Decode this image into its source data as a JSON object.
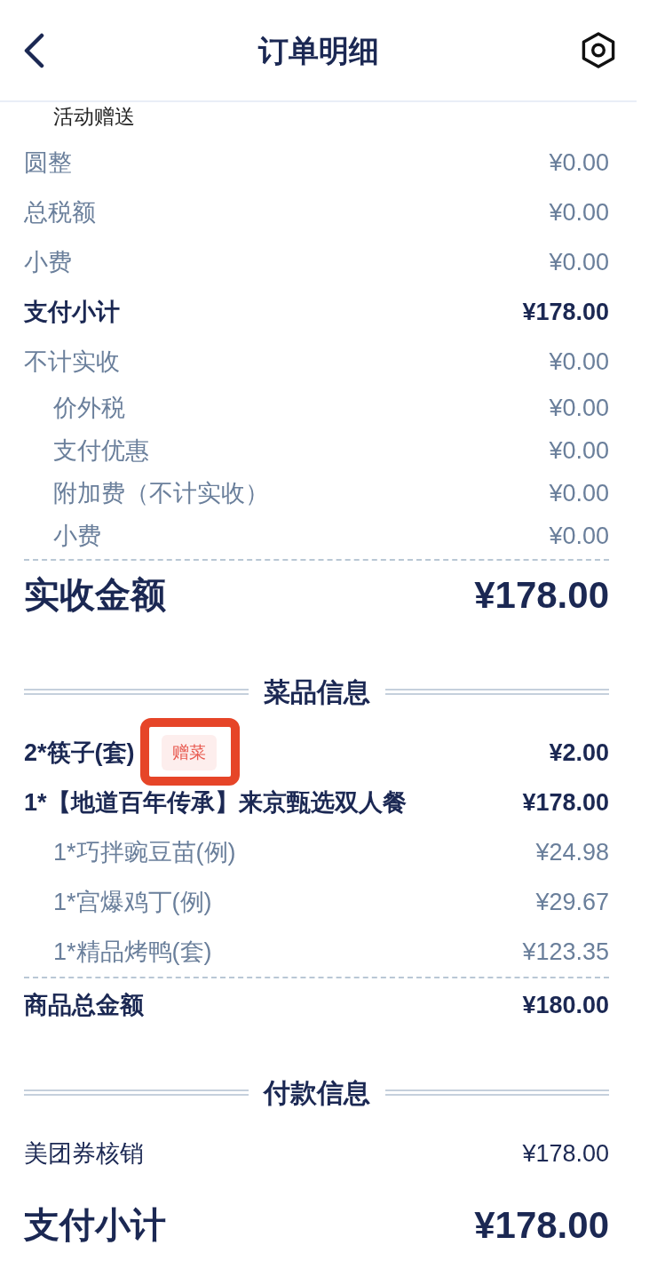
{
  "header": {
    "title": "订单明细"
  },
  "amounts": [
    {
      "kind": "note",
      "label": "活动赠送"
    },
    {
      "kind": "minor",
      "label": "圆整",
      "value": "¥0.00"
    },
    {
      "kind": "minor",
      "label": "总税额",
      "value": "¥0.00"
    },
    {
      "kind": "minor",
      "label": "小费",
      "value": "¥0.00"
    },
    {
      "kind": "strong",
      "label": "支付小计",
      "value": "¥178.00"
    },
    {
      "kind": "minor",
      "label": "不计实收",
      "value": "¥0.00",
      "children": [
        {
          "label": "价外税",
          "value": "¥0.00"
        },
        {
          "label": "支付优惠",
          "value": "¥0.00"
        },
        {
          "label": "附加费（不计实收）",
          "value": "¥0.00"
        },
        {
          "label": "小费",
          "value": "¥0.00"
        }
      ]
    }
  ],
  "received_total": {
    "label": "实收金额",
    "value": "¥178.00"
  },
  "dish_section": {
    "title": "菜品信息",
    "dishes": [
      {
        "name": "2*筷子(套)",
        "price": "¥2.00",
        "badge": "赠菜",
        "highlighted": true
      },
      {
        "name": "1*【地道百年传承】来京甄选双人餐",
        "price": "¥178.00",
        "highlighted": false,
        "children": [
          {
            "name": "1*巧拌豌豆苗(例)",
            "price": "¥24.98"
          },
          {
            "name": "1*宫爆鸡丁(例)",
            "price": "¥29.67"
          },
          {
            "name": "1*精品烤鸭(套)",
            "price": "¥123.35"
          }
        ]
      }
    ],
    "total": {
      "label": "商品总金额",
      "value": "¥180.00"
    }
  },
  "payment_section": {
    "title": "付款信息",
    "rows": [
      {
        "label": "美团券核销",
        "value": "¥178.00"
      }
    ],
    "subtotal": {
      "label": "支付小计",
      "value": "¥178.00"
    }
  }
}
